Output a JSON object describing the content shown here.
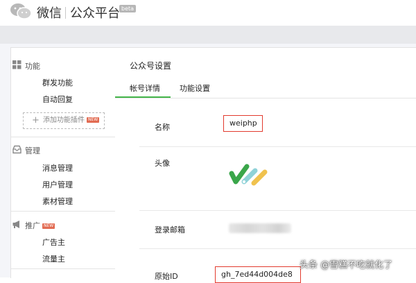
{
  "header": {
    "brand_name": "微信",
    "brand_sub": "公众平台",
    "beta": "beta"
  },
  "sidebar": {
    "groups": [
      {
        "title": "功能",
        "icon": "grid-icon",
        "items": [
          "群发功能",
          "自动回复"
        ]
      },
      {
        "title": "管理",
        "icon": "inbox-icon",
        "items": [
          "消息管理",
          "用户管理",
          "素材管理"
        ]
      },
      {
        "title": "推广",
        "icon": "megaphone-icon",
        "badge": "NEW",
        "items": [
          "广告主",
          "流量主"
        ]
      }
    ],
    "add_plugin": {
      "plus": "+",
      "label": "添加功能插件",
      "badge": "NEW"
    }
  },
  "main": {
    "title": "公众号设置",
    "tabs": [
      {
        "label": "帐号详情",
        "active": true
      },
      {
        "label": "功能设置",
        "active": false
      }
    ],
    "fields": {
      "name_label": "名称",
      "name_value": "weiphp",
      "avatar_label": "头像",
      "email_label": "登录邮箱",
      "email_value_hidden": true,
      "origin_id_label": "原始ID",
      "origin_id_value": "gh_7ed44d004de8"
    }
  },
  "watermark": "头条 @雪糕不吃就化了",
  "colors": {
    "accent": "#44b549",
    "highlight_box": "#e23a2e",
    "new_badge": "#e26b52"
  }
}
